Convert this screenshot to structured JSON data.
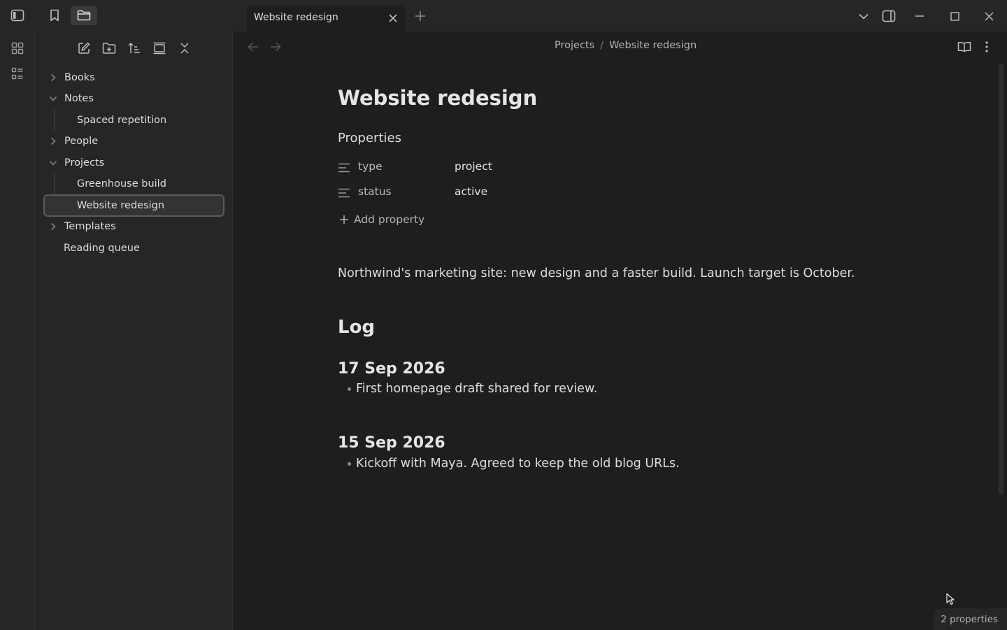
{
  "tab": {
    "title": "Website redesign"
  },
  "explorer": {
    "items": [
      {
        "label": "Books",
        "state": "collapsed"
      },
      {
        "label": "Notes",
        "state": "expanded"
      },
      {
        "label": "Spaced repetition",
        "state": "file"
      },
      {
        "label": "People",
        "state": "collapsed"
      },
      {
        "label": "Projects",
        "state": "expanded"
      },
      {
        "label": "Greenhouse build",
        "state": "file"
      },
      {
        "label": "Website redesign",
        "state": "file-selected"
      },
      {
        "label": "Templates",
        "state": "collapsed"
      },
      {
        "label": "Reading queue",
        "state": "file"
      }
    ]
  },
  "breadcrumb": {
    "parent": "Projects",
    "separator": "/",
    "current": "Website redesign"
  },
  "note": {
    "title": "Website redesign",
    "properties_heading": "Properties",
    "properties": [
      {
        "key": "type",
        "value": "project"
      },
      {
        "key": "status",
        "value": "active"
      }
    ],
    "add_property": "Add property",
    "paragraph": "Northwind's marketing site: new design and a faster build. Launch target is October.",
    "log_heading": "Log",
    "entries": [
      {
        "date": "17 Sep 2026",
        "bullet": "First homepage draft shared for review."
      },
      {
        "date": "15 Sep 2026",
        "bullet": "Kickoff with Maya. Agreed to keep the old blog URLs."
      }
    ]
  },
  "statusbar": {
    "properties_count": "2 properties"
  },
  "colors": {
    "background": "#1e1e1e",
    "panel": "#262626",
    "text": "#dcddde",
    "muted": "#b3b3b3"
  }
}
